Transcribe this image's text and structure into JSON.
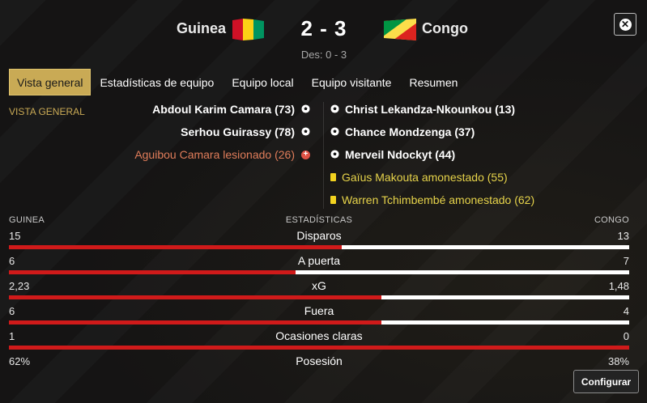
{
  "match": {
    "home_team": "Guinea",
    "away_team": "Congo",
    "score": "2 - 3",
    "halftime": "Des: 0 - 3"
  },
  "tabs": [
    "Vista general",
    "Estadísticas de equipo",
    "Equipo local",
    "Equipo visitante",
    "Resumen"
  ],
  "active_tab": "Vista general",
  "section_label": "VISTA GENERAL",
  "home_events": [
    {
      "text": "Abdoul Karim Camara (73)",
      "type": "goal"
    },
    {
      "text": "Serhou Guirassy (78)",
      "type": "goal"
    },
    {
      "text": "Aguibou Camara lesionado (26)",
      "type": "injury"
    }
  ],
  "away_events": [
    {
      "text": "Christ Lekandza-Nkounkou (13)",
      "type": "goal"
    },
    {
      "text": "Chance Mondzenga (37)",
      "type": "goal"
    },
    {
      "text": "Merveil Ndockyt (44)",
      "type": "goal"
    },
    {
      "text": "Gaïus Makouta amonestado (55)",
      "type": "yellow-card"
    },
    {
      "text": "Warren Tchimbembé amonestado (62)",
      "type": "yellow-card"
    }
  ],
  "stats_header": {
    "home": "GUINEA",
    "title": "ESTADÍSTICAS",
    "away": "CONGO"
  },
  "stats": [
    {
      "name": "Disparos",
      "home": "15",
      "away": "13",
      "home_share": 0.536
    },
    {
      "name": "A puerta",
      "home": "6",
      "away": "7",
      "home_share": 0.462
    },
    {
      "name": "xG",
      "home": "2,23",
      "away": "1,48",
      "home_share": 0.601
    },
    {
      "name": "Fuera",
      "home": "6",
      "away": "4",
      "home_share": 0.6
    },
    {
      "name": "Ocasiones claras",
      "home": "1",
      "away": "0",
      "home_share": 1.0
    },
    {
      "name": "Posesión",
      "home": "62%",
      "away": "38%",
      "home_share": 0.62
    }
  ],
  "buttons": {
    "configure": "Configurar"
  },
  "colors": {
    "accent_gold": "#c9aa55",
    "home_bar": "#d01a1a",
    "away_bar": "#ffffff",
    "yellow_event": "#e6d34a",
    "injury_event": "#e07d5a"
  }
}
